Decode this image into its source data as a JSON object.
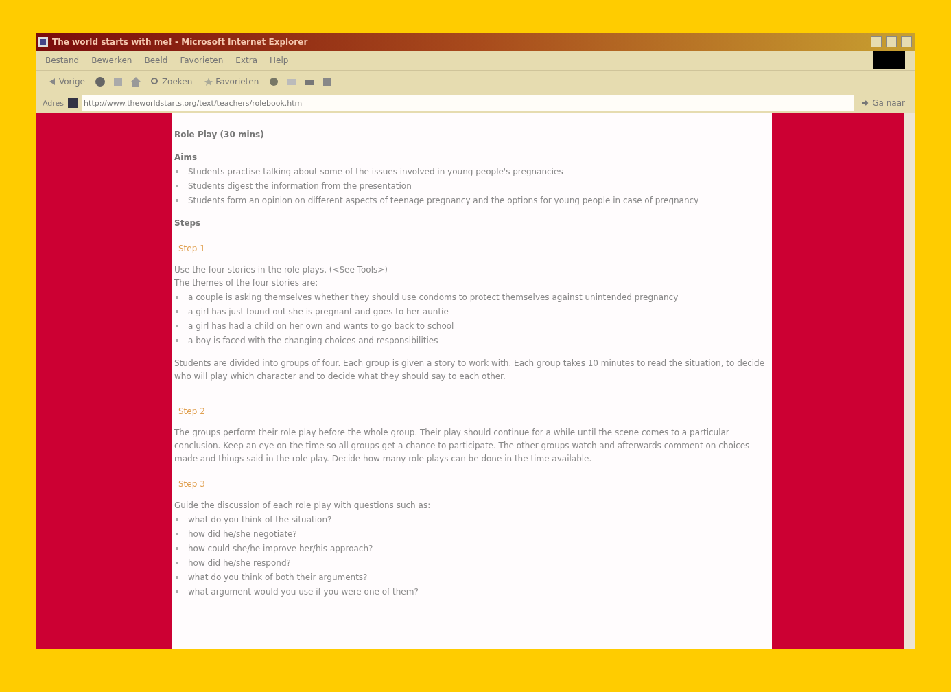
{
  "window": {
    "title": "The world starts with me! - Microsoft Internet Explorer"
  },
  "menu": [
    "Bestand",
    "Bewerken",
    "Beeld",
    "Favorieten",
    "Extra",
    "Help"
  ],
  "toolbar": {
    "back": "Vorige",
    "search": "Zoeken",
    "favorites": "Favorieten"
  },
  "address": {
    "label": "Adres",
    "value": "http://www.theworldstarts.org/text/teachers/rolebook.htm",
    "go": "Ga naar"
  },
  "content": {
    "title": "Role Play (30 mins)",
    "aims_heading": "Aims",
    "aims": [
      "Students practise talking about some of the issues involved in young people's pregnancies",
      "Students digest the information from the presentation",
      "Students form an opinion on different aspects of teenage pregnancy and the options for young people in case of pregnancy"
    ],
    "steps_heading": "Steps",
    "steps": [
      {
        "label": "Step 1",
        "paragraphs": [
          "Use the four stories in the role plays. (<See Tools>)",
          "The themes of the four stories are:"
        ],
        "bullets": [
          "a couple is asking themselves whether they should use condoms to protect themselves against unintended pregnancy",
          "a girl has just found out she is pregnant and goes to her auntie",
          "a girl has had a child on her own and wants to go back to school",
          "a boy is faced with the changing choices and responsibilities"
        ],
        "after": "Students are divided into groups of four. Each group is given a story to work with. Each group takes 10 minutes to read the situation, to decide who will play which character and to decide what they should say to each other."
      },
      {
        "label": "Step 2",
        "paragraphs": [
          "The groups perform their role play before the whole group. Their play should continue for a while until the scene comes to a particular conclusion. Keep an eye on the time so all groups get a chance to participate. The other groups watch and afterwards comment on choices made and things said in the role play. Decide how many role plays can be done in the time available."
        ]
      },
      {
        "label": "Step 3",
        "paragraphs": [
          "Guide the discussion of each role play with questions such as:"
        ],
        "bullets": [
          "what do you think of the situation?",
          "how did he/she negotiate?",
          "how could she/he improve her/his approach?",
          "how did he/she respond?",
          "what do you think of both their arguments?",
          "what argument would you use if you were one of them?"
        ]
      }
    ]
  }
}
